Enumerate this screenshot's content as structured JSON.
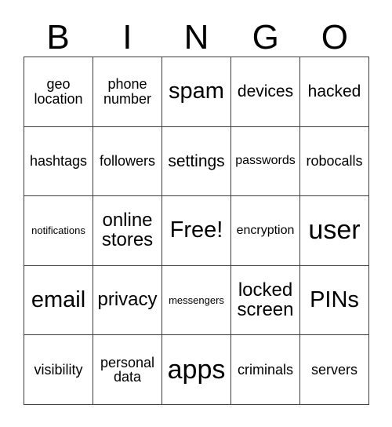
{
  "card": {
    "type": "bingo-card",
    "columns": 5,
    "rows": 5,
    "header_letters": [
      "B",
      "I",
      "N",
      "G",
      "O"
    ],
    "free_space": "Free!",
    "free_space_position": {
      "row": 3,
      "column": 3
    },
    "border_color": "#3b3b3b",
    "background_color": "#ffffff",
    "text_color": "#000000",
    "cells": [
      [
        {
          "text": "geo location",
          "size": "md"
        },
        {
          "text": "phone number",
          "size": "md"
        },
        {
          "text": "spam",
          "size": "2xl"
        },
        {
          "text": "devices",
          "size": "lg"
        },
        {
          "text": "hacked",
          "size": "lg"
        }
      ],
      [
        {
          "text": "hashtags",
          "size": "md"
        },
        {
          "text": "followers",
          "size": "md"
        },
        {
          "text": "settings",
          "size": "lg"
        },
        {
          "text": "passwords",
          "size": "sm"
        },
        {
          "text": "robocalls",
          "size": "md"
        }
      ],
      [
        {
          "text": "notifications",
          "size": "xs"
        },
        {
          "text": "online stores",
          "size": "xl"
        },
        {
          "text": "Free!",
          "size": "2xl"
        },
        {
          "text": "encryption",
          "size": "sm"
        },
        {
          "text": "user",
          "size": "3xl"
        }
      ],
      [
        {
          "text": "email",
          "size": "2xl"
        },
        {
          "text": "privacy",
          "size": "xl"
        },
        {
          "text": "messengers",
          "size": "xs"
        },
        {
          "text": "locked screen",
          "size": "xl"
        },
        {
          "text": "PINs",
          "size": "2xl"
        }
      ],
      [
        {
          "text": "visibility",
          "size": "md"
        },
        {
          "text": "personal data",
          "size": "md"
        },
        {
          "text": "apps",
          "size": "3xl"
        },
        {
          "text": "criminals",
          "size": "md"
        },
        {
          "text": "servers",
          "size": "md"
        }
      ]
    ]
  }
}
